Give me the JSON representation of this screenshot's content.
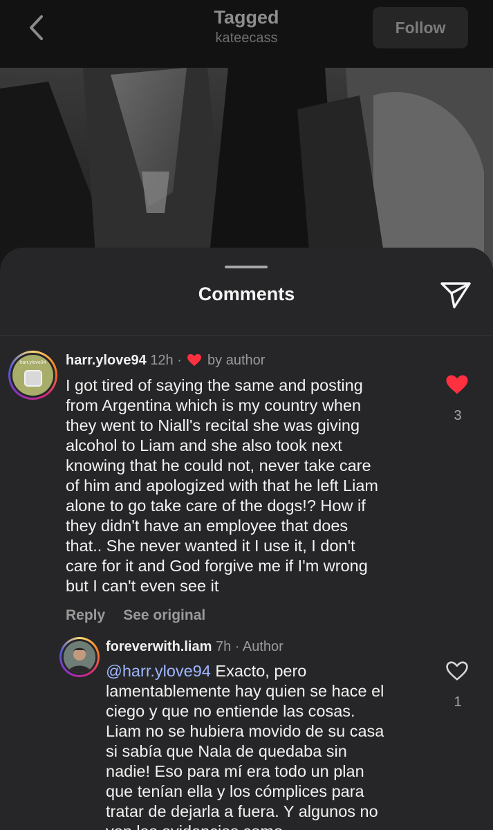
{
  "header": {
    "title": "Tagged",
    "subtitle": "kateecass",
    "follow_label": "Follow"
  },
  "sheet": {
    "title": "Comments"
  },
  "comments": [
    {
      "username": "harr.ylove94",
      "avatar_text": "harr.ylove94",
      "time": "12h",
      "separator": " · ",
      "badge_label": "by author",
      "lines": [
        "I got tired of saying the same and posting",
        "from Argentina which is my country when",
        "they went to Niall's recital she was giving",
        "alcohol to Liam and she also took next",
        "knowing that he could not, never take care",
        "of him and apologized with that he left Liam",
        "alone to go take care of the dogs!? How if",
        "they didn't have an employee that does",
        "that.. She never wanted it I use it, I don't",
        "care for it and God forgive me if I'm wrong",
        "but I can't even see it"
      ],
      "likes": "3",
      "liked": true,
      "reply_label": "Reply",
      "see_original_label": "See original"
    },
    {
      "username": "foreverwith.liam",
      "time": "7h",
      "separator": " · ",
      "role": "Author",
      "mention": "@harr.ylove94",
      "first_line_rest": " Exacto, pero",
      "lines": [
        "lamentablemente hay quien se hace el",
        "ciego y que no entiende las cosas.",
        "Liam no se hubiera movido de su casa",
        "si sabía que Nala de quedaba sin",
        "nadie! Eso para mí era todo un plan",
        "que tenían ella y los cómplices para",
        "tratar de dejarla a fuera. Y algunos no",
        "ven las evidencias como"
      ],
      "likes": "1",
      "liked": false
    }
  ],
  "icons": {
    "back": "chevron-left-icon",
    "share": "paper-plane-icon",
    "heart_filled": "heart-filled-icon",
    "heart_outline": "heart-outline-icon"
  },
  "colors": {
    "heart": "#ff3040",
    "mention": "#9fb6ff",
    "sheet_bg": "#262628"
  }
}
